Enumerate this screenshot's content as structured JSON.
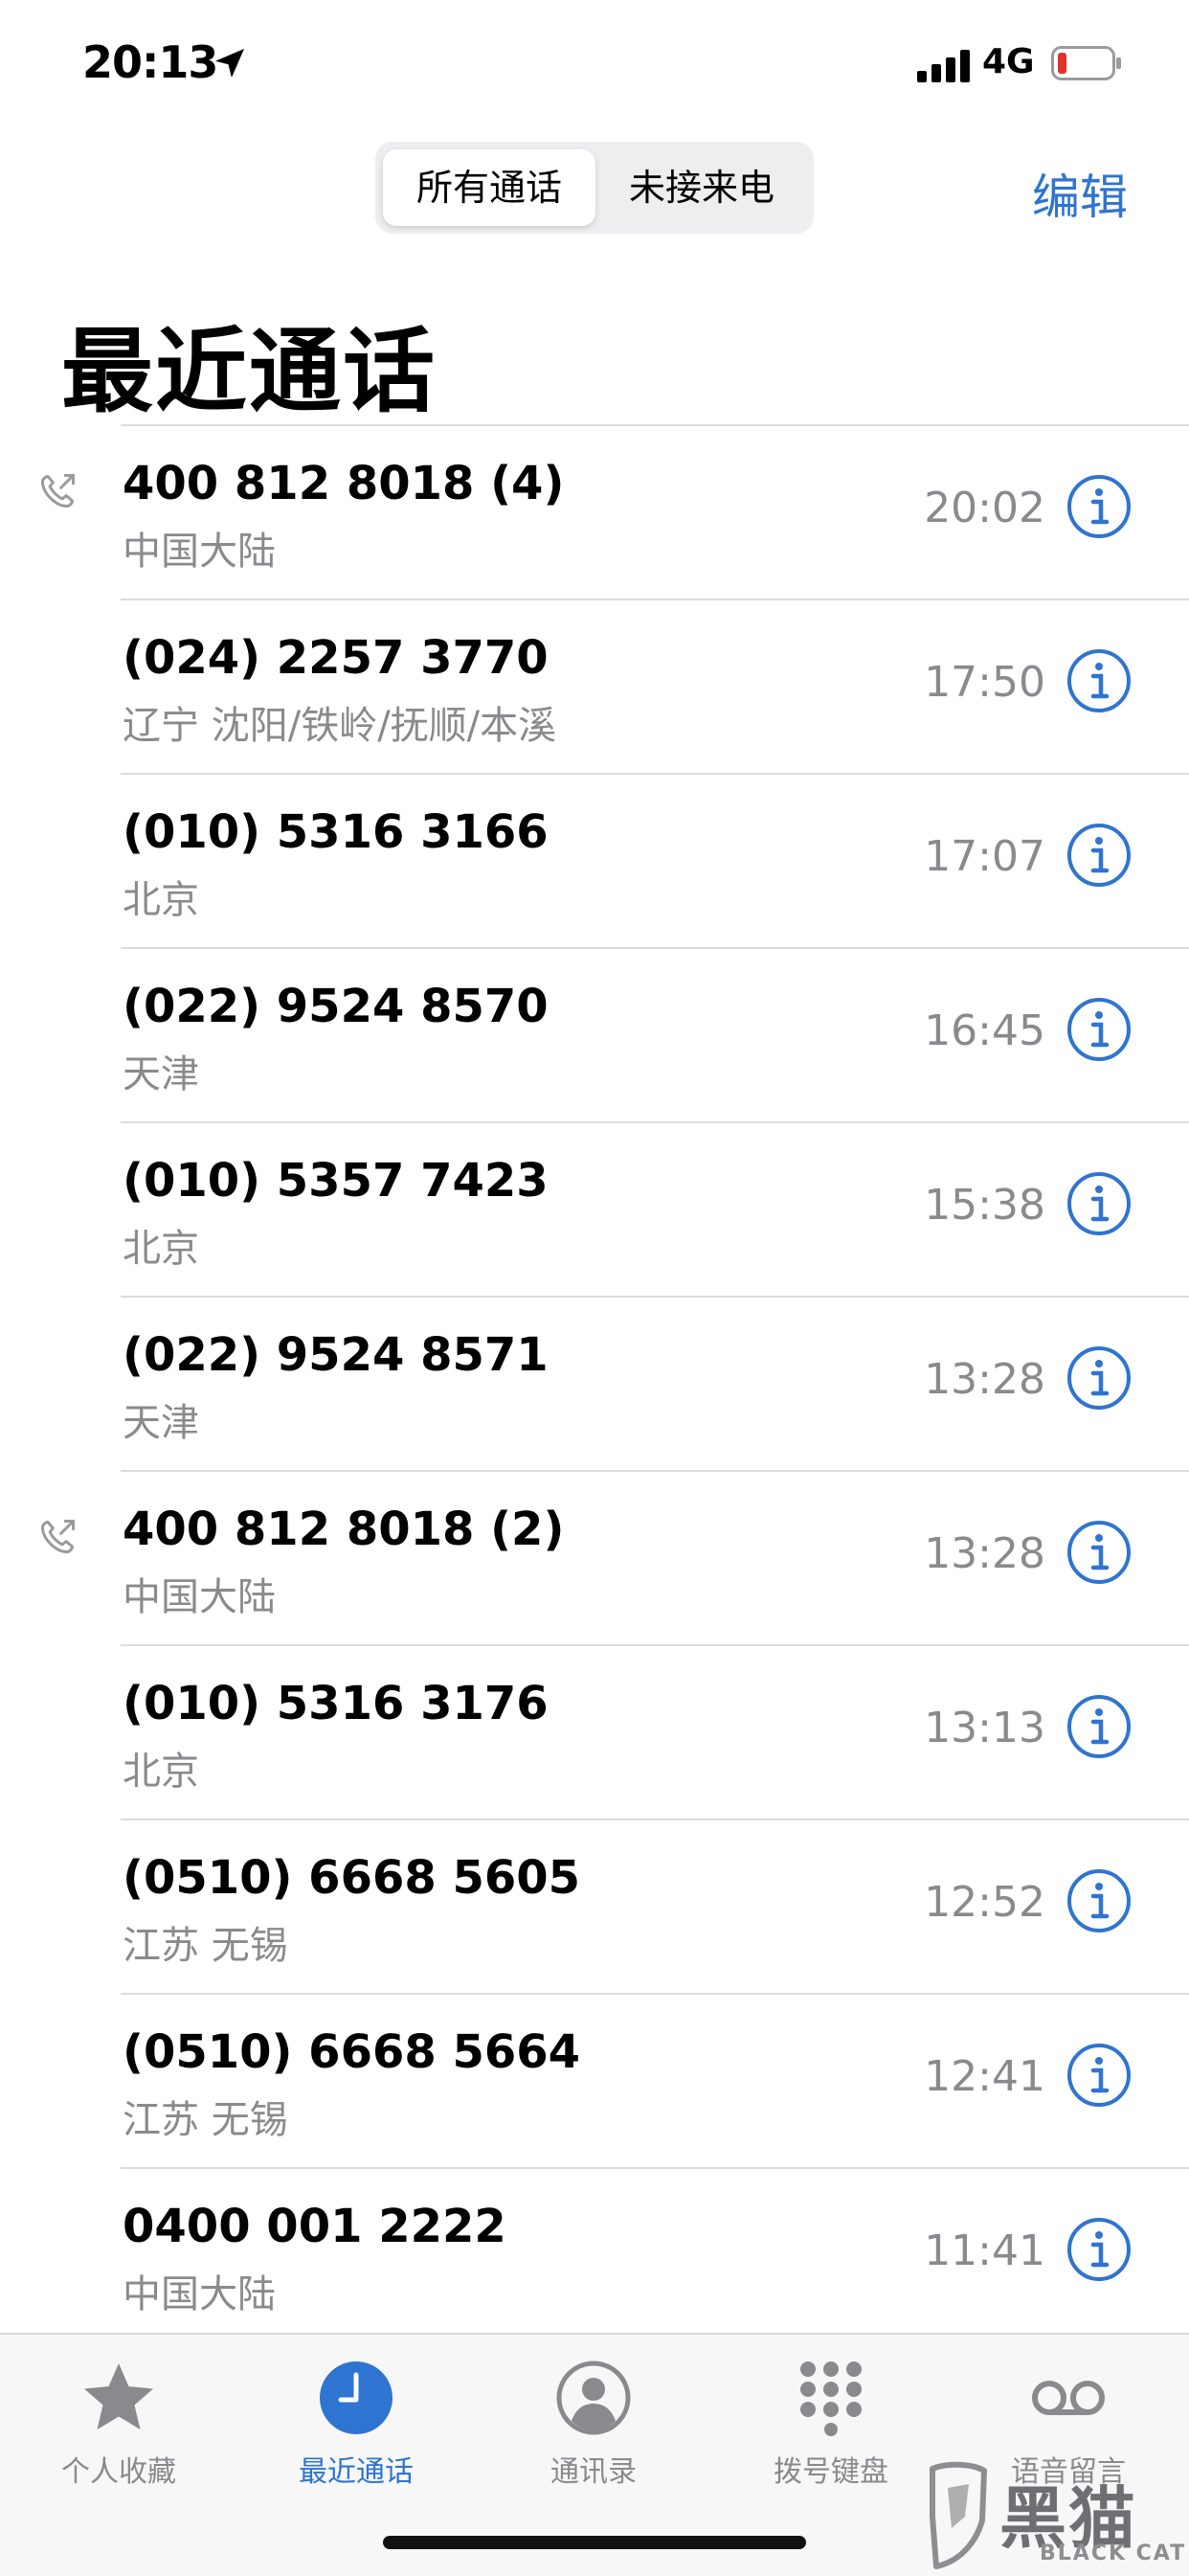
{
  "status_bar": {
    "time": "20:13",
    "network": "4G"
  },
  "header": {
    "segments": [
      {
        "label": "所有通话",
        "selected": true
      },
      {
        "label": "未接来电",
        "selected": false
      }
    ],
    "edit_label": "编辑",
    "title": "最近通话"
  },
  "calls": [
    {
      "number": "400 812 8018 (4)",
      "location": "中国大陆",
      "time": "20:02",
      "outgoing": true
    },
    {
      "number": "(024) 2257 3770",
      "location": "辽宁 沈阳/铁岭/抚顺/本溪",
      "time": "17:50",
      "outgoing": false
    },
    {
      "number": "(010) 5316 3166",
      "location": "北京",
      "time": "17:07",
      "outgoing": false
    },
    {
      "number": "(022) 9524 8570",
      "location": "天津",
      "time": "16:45",
      "outgoing": false
    },
    {
      "number": "(010) 5357 7423",
      "location": "北京",
      "time": "15:38",
      "outgoing": false
    },
    {
      "number": "(022) 9524 8571",
      "location": "天津",
      "time": "13:28",
      "outgoing": false
    },
    {
      "number": "400 812 8018 (2)",
      "location": "中国大陆",
      "time": "13:28",
      "outgoing": true
    },
    {
      "number": "(010) 5316 3176",
      "location": "北京",
      "time": "13:13",
      "outgoing": false
    },
    {
      "number": "(0510) 6668 5605",
      "location": "江苏 无锡",
      "time": "12:52",
      "outgoing": false
    },
    {
      "number": "(0510) 6668 5664",
      "location": "江苏 无锡",
      "time": "12:41",
      "outgoing": false
    },
    {
      "number": "0400 001 2222",
      "location": "中国大陆",
      "time": "11:41",
      "outgoing": false
    }
  ],
  "tabbar": {
    "items": [
      {
        "label": "个人收藏",
        "icon": "star-icon",
        "active": false
      },
      {
        "label": "最近通话",
        "icon": "clock-icon",
        "active": true
      },
      {
        "label": "通讯录",
        "icon": "person-icon",
        "active": false
      },
      {
        "label": "拨号键盘",
        "icon": "keypad-icon",
        "active": false
      },
      {
        "label": "语音留言",
        "icon": "voicemail-icon",
        "active": false
      }
    ]
  },
  "watermark": {
    "text": "黑猫",
    "subtext": "BLACK CAT"
  },
  "colors": {
    "accent": "#2f74d0",
    "secondary_text": "#8a8a8e",
    "battery_low": "#e0332b"
  }
}
